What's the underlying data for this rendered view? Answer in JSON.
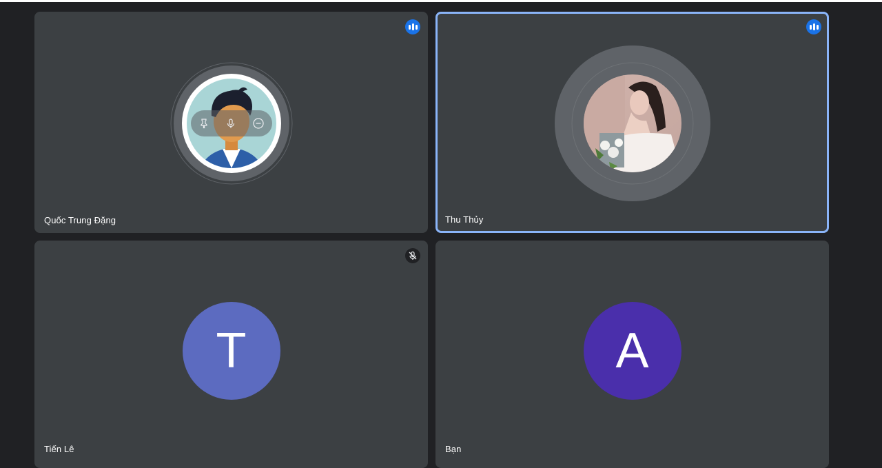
{
  "participants": [
    {
      "name": "Quốc Trung Đặng",
      "status": "speaking",
      "avatar": "cartoon-person-icon",
      "hover_controls": [
        "pin-icon",
        "mic-icon",
        "remove-icon"
      ]
    },
    {
      "name": "Thu Thủy",
      "status": "speaking",
      "avatar": "profile-photo",
      "active_speaker": true
    },
    {
      "name": "Tiến Lê",
      "status": "muted",
      "avatar_letter": "T",
      "avatar_color": "#5c6bc0"
    },
    {
      "name": "Bạn",
      "avatar_letter": "A",
      "avatar_color": "#4a2fab"
    }
  ],
  "colors": {
    "background": "#202124",
    "tile": "#3c4043",
    "active_border": "#8ab4f8",
    "speaking_badge": "#1a73e8"
  }
}
